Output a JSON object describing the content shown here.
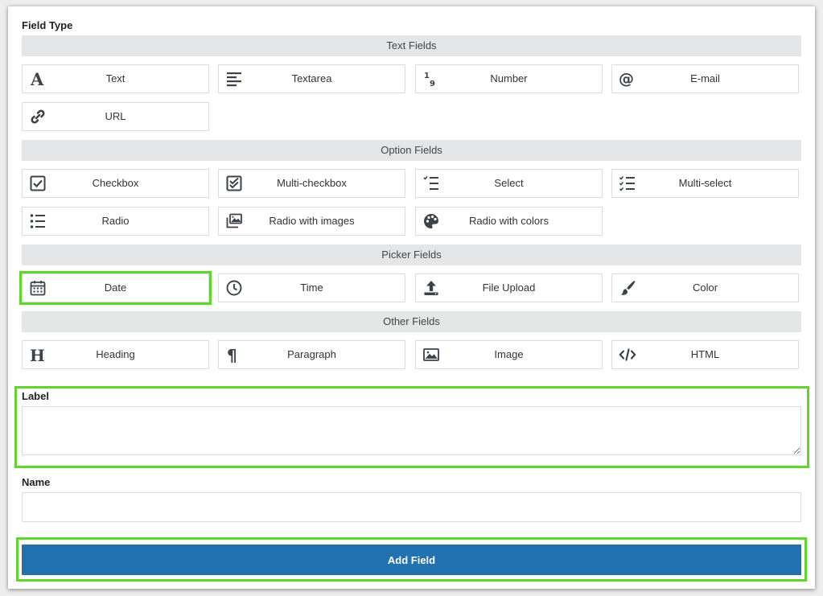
{
  "form": {
    "field_type_label": "Field Type",
    "sections": {
      "text": {
        "title": "Text Fields",
        "items": [
          {
            "label": "Text",
            "icon": "text-a-icon"
          },
          {
            "label": "Textarea",
            "icon": "align-left-icon"
          },
          {
            "label": "Number",
            "icon": "number-icon"
          },
          {
            "label": "E-mail",
            "icon": "at-sign-icon"
          },
          {
            "label": "URL",
            "icon": "link-icon"
          }
        ]
      },
      "option": {
        "title": "Option Fields",
        "items": [
          {
            "label": "Checkbox",
            "icon": "checkbox-icon"
          },
          {
            "label": "Multi-checkbox",
            "icon": "multi-checkbox-icon"
          },
          {
            "label": "Select",
            "icon": "select-list-icon"
          },
          {
            "label": "Multi-select",
            "icon": "multi-select-list-icon"
          },
          {
            "label": "Radio",
            "icon": "radio-list-icon"
          },
          {
            "label": "Radio with images",
            "icon": "images-icon"
          },
          {
            "label": "Radio with colors",
            "icon": "palette-icon"
          }
        ]
      },
      "picker": {
        "title": "Picker Fields",
        "items": [
          {
            "label": "Date",
            "icon": "calendar-icon"
          },
          {
            "label": "Time",
            "icon": "clock-icon"
          },
          {
            "label": "File Upload",
            "icon": "upload-icon"
          },
          {
            "label": "Color",
            "icon": "paintbrush-icon"
          }
        ]
      },
      "other": {
        "title": "Other Fields",
        "items": [
          {
            "label": "Heading",
            "icon": "heading-icon"
          },
          {
            "label": "Paragraph",
            "icon": "paragraph-icon"
          },
          {
            "label": "Image",
            "icon": "image-icon"
          },
          {
            "label": "HTML",
            "icon": "code-icon"
          }
        ]
      }
    },
    "label_field": {
      "label": "Label",
      "value": ""
    },
    "name_field": {
      "label": "Name",
      "value": ""
    },
    "submit_label": "Add Field"
  },
  "colors": {
    "highlight": "#5fd62b",
    "button": "#2271b1",
    "section_bg": "#e4e5e7",
    "icon": "#3c434a"
  }
}
